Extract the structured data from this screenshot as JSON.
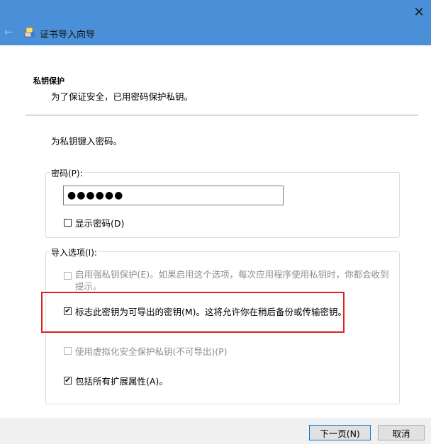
{
  "window": {
    "title": "证书导入向导",
    "close_glyph": "✕",
    "back_glyph": "←"
  },
  "header": {
    "section_title": "私钥保护",
    "section_description": "为了保证安全，已用密码保护私钥。"
  },
  "instruction": "为私钥键入密码。",
  "password_group": {
    "label": "密码(P):",
    "masked_value": "●●●●●●",
    "show_password_label": "显示密码(D)",
    "show_password_checked": false
  },
  "import_options": {
    "label": "导入选项(I):",
    "options": [
      {
        "label": "启用强私钥保护(E)。如果启用这个选项，每次应用程序使用私钥时，你都会收到提示。",
        "checked": false,
        "enabled": false
      },
      {
        "label": "标志此密钥为可导出的密钥(M)。这将允许你在稍后备份或传输密钥。",
        "checked": true,
        "enabled": true
      },
      {
        "label": "使用虚拟化安全保护私钥(不可导出)(P)",
        "checked": false,
        "enabled": false
      },
      {
        "label": "包括所有扩展属性(A)。",
        "checked": true,
        "enabled": true
      }
    ]
  },
  "footer": {
    "next_label": "下一页(N)",
    "cancel_label": "取消"
  },
  "colors": {
    "titlebar": "#4a90d9",
    "highlight": "#e02020"
  },
  "check_glyph": "✔"
}
